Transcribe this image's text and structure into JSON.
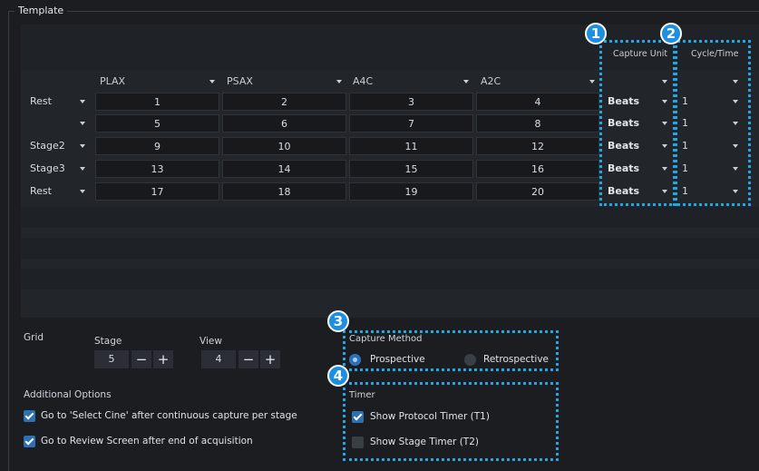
{
  "template": {
    "title": "Template",
    "columns": [
      {
        "label": "PLAX"
      },
      {
        "label": "PSAX"
      },
      {
        "label": "A4C"
      },
      {
        "label": "A2C"
      }
    ],
    "capture_unit_header": "Capture Unit",
    "cycle_time_header": "Cycle/Time",
    "rows": [
      {
        "label": "Rest",
        "cells": [
          "1",
          "2",
          "3",
          "4"
        ],
        "unit": "Beats",
        "cycle": "1"
      },
      {
        "label": "",
        "cells": [
          "5",
          "6",
          "7",
          "8"
        ],
        "unit": "Beats",
        "cycle": "1"
      },
      {
        "label": "Stage2",
        "cells": [
          "9",
          "10",
          "11",
          "12"
        ],
        "unit": "Beats",
        "cycle": "1"
      },
      {
        "label": "Stage3",
        "cells": [
          "13",
          "14",
          "15",
          "16"
        ],
        "unit": "Beats",
        "cycle": "1"
      },
      {
        "label": "Rest",
        "cells": [
          "17",
          "18",
          "19",
          "20"
        ],
        "unit": "Beats",
        "cycle": "1"
      }
    ]
  },
  "grid": {
    "label": "Grid",
    "stage": {
      "label": "Stage",
      "value": "5",
      "minus": "−",
      "plus": "+"
    },
    "view": {
      "label": "View",
      "value": "4",
      "minus": "−",
      "plus": "+"
    }
  },
  "capture_method": {
    "label": "Capture Method",
    "options": [
      {
        "label": "Prospective",
        "selected": true
      },
      {
        "label": "Retrospective",
        "selected": false
      }
    ]
  },
  "additional_options": {
    "label": "Additional Options",
    "items": [
      {
        "label": "Go to 'Select Cine' after continuous capture per stage",
        "checked": true
      },
      {
        "label": "Go to Review Screen after end of acquisition",
        "checked": true
      }
    ]
  },
  "timer": {
    "label": "Timer",
    "items": [
      {
        "label": "Show Protocol Timer (T1)",
        "checked": true
      },
      {
        "label": "Show Stage Timer (T2)",
        "checked": false
      }
    ]
  },
  "callouts": [
    "1",
    "2",
    "3",
    "4"
  ],
  "colors": {
    "accent": "#22a7e6",
    "badge": "#1c8fe0",
    "checkbox": "#2f6fb3"
  }
}
